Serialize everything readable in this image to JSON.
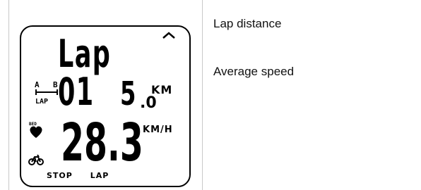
{
  "display": {
    "title": "Lap 01",
    "distance_integer": "5",
    "distance_decimal": ".0",
    "distance_unit": "KM",
    "speed_value": "28.3",
    "speed_unit": "KM/H",
    "ab_labels": [
      "A",
      "B"
    ],
    "ab_lap_label": "LAP",
    "hr_indicator_label": "BED",
    "softkeys": [
      "STOP",
      "LAP"
    ]
  },
  "descriptions": {
    "lap_distance": "Lap distance",
    "average_speed": "Average speed"
  },
  "icons": [
    "up-arrow-icon",
    "ab-lap-icon",
    "heart-icon",
    "bike-icon"
  ]
}
